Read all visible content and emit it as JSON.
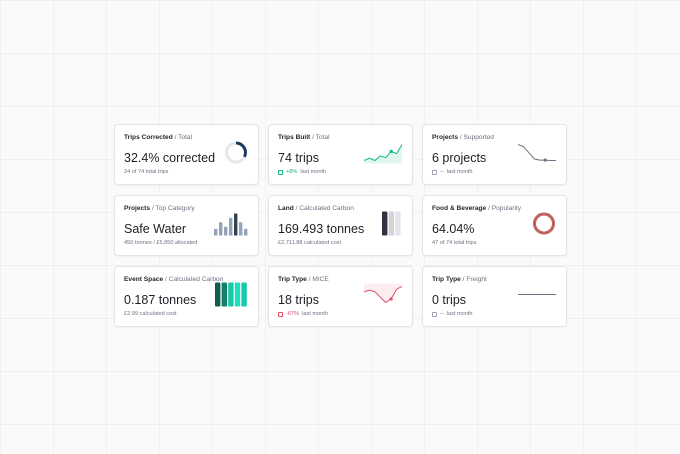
{
  "cards": [
    {
      "title": "Trips Corrected",
      "sep": " / ",
      "subtitle": "Total",
      "value": "32.4% corrected",
      "sub": "24 of 74 total trips",
      "ring": {
        "fraction": 0.324,
        "color": "#1e3a5f"
      }
    },
    {
      "title": "Trips Built",
      "sep": " / ",
      "subtitle": "Total",
      "value": "74 trips",
      "delta": "+8%",
      "delta_dir": "up",
      "sub": "last month",
      "spark": {
        "color": "#10b981",
        "values": [
          2,
          2.5,
          2,
          3,
          2.6,
          4,
          3.5,
          5.5
        ]
      }
    },
    {
      "title": "Projects",
      "sep": " / ",
      "subtitle": "Supported",
      "value": "6 projects",
      "delta": "--",
      "delta_dir": "flat",
      "sub": "last month",
      "spark": {
        "color": "#6b7280",
        "values": [
          5,
          4.5,
          3,
          1.5,
          1.2,
          1.2,
          1.1,
          1.1
        ]
      }
    },
    {
      "title": "Projects",
      "sep": " / ",
      "subtitle": "Top Category",
      "value": "Safe Water",
      "sub": "450 tonnes / £5,850 allocated",
      "bars": {
        "values": [
          3,
          6,
          4,
          8,
          10,
          6,
          3
        ],
        "colors": [
          "#94a3b8",
          "#94a3b8",
          "#94a3b8",
          "#94a3b8",
          "#334155",
          "#94a3b8",
          "#94a3b8"
        ]
      }
    },
    {
      "title": "Land",
      "sep": " / ",
      "subtitle": "Calculated Carbon",
      "value": "169.493 tonnes",
      "sub": "£2,711.88 calculated cost",
      "blocks": {
        "colors": [
          "#2f3440",
          "#d4d4d8",
          "#e4e4ea"
        ]
      }
    },
    {
      "title": "Food & Beverage",
      "sep": " / ",
      "subtitle": "Popularity",
      "value": "64.04%",
      "sub": "47 of 74 total trips",
      "ring": {
        "fraction": 1.0,
        "color": "#c0625a"
      }
    },
    {
      "title": "Event Space",
      "sep": " / ",
      "subtitle": "Calculated Carbon",
      "value": "0.187 tonnes",
      "sub": "£2.99 calculated cost",
      "blocks": {
        "colors": [
          "#0f5e4c",
          "#14806a",
          "#19c7a5",
          "#19e0bd",
          "#16c9aa"
        ]
      }
    },
    {
      "title": "Trip Type",
      "sep": " / ",
      "subtitle": "MICE",
      "value": "18 trips",
      "delta": "-67%",
      "delta_dir": "down",
      "sub": "last month",
      "spark": {
        "color": "#e0506a",
        "values": [
          3,
          3.2,
          3,
          2.4,
          1.8,
          2.2,
          3.3,
          3.6
        ]
      }
    },
    {
      "title": "Trip Type",
      "sep": " / ",
      "subtitle": "Freight",
      "value": "0 trips",
      "delta": "--",
      "delta_dir": "flat",
      "sub": "last month",
      "spark": {
        "color": "#6b7280",
        "values": [
          1,
          1,
          1,
          1,
          1,
          1,
          1,
          1
        ]
      }
    }
  ]
}
